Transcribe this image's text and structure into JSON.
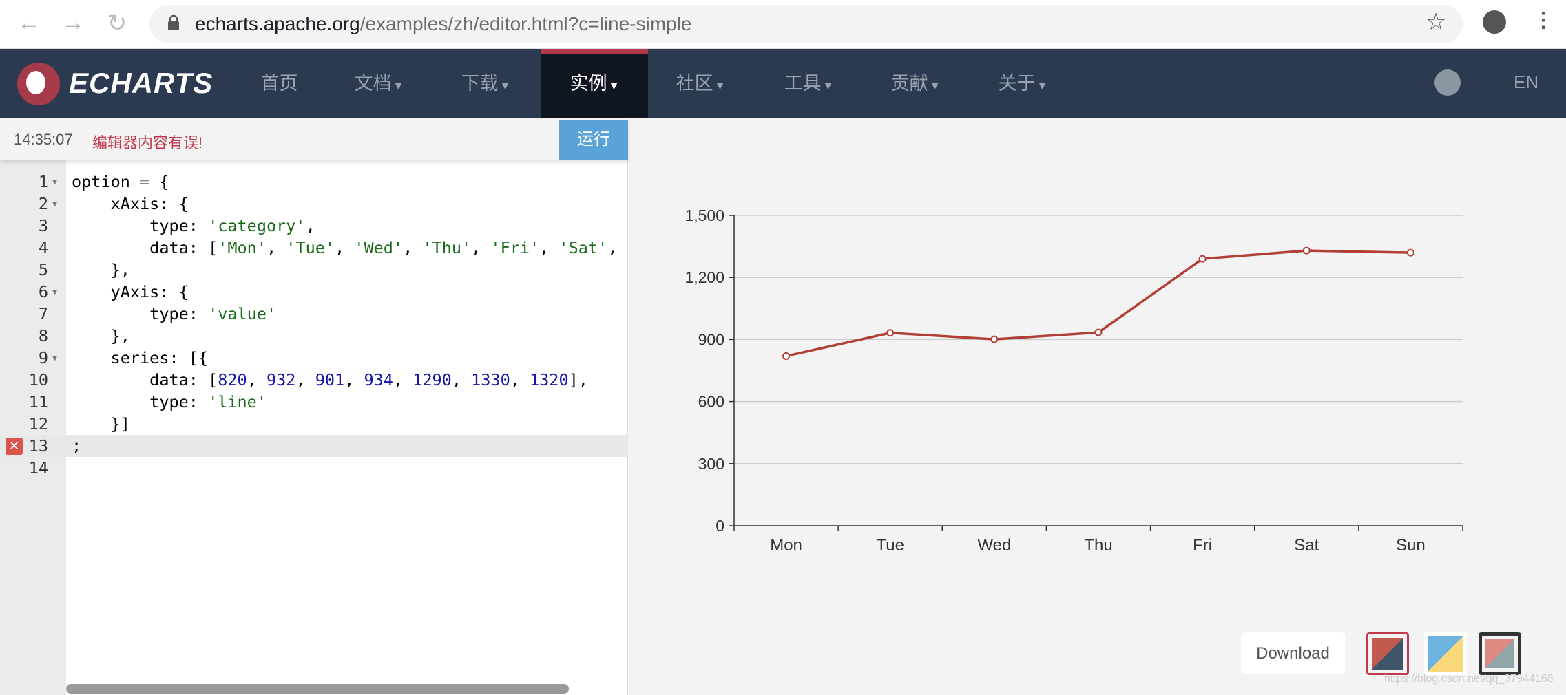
{
  "browser": {
    "url_host": "echarts.apache.org",
    "url_path": "/examples/zh/editor.html?c=line-simple"
  },
  "nav": {
    "logo": "ECHARTS",
    "items": [
      {
        "label": "首页",
        "dropdown": false
      },
      {
        "label": "文档",
        "dropdown": true
      },
      {
        "label": "下载",
        "dropdown": true
      },
      {
        "label": "实例",
        "dropdown": true,
        "active": true
      },
      {
        "label": "社区",
        "dropdown": true
      },
      {
        "label": "工具",
        "dropdown": true
      },
      {
        "label": "贡献",
        "dropdown": true
      },
      {
        "label": "关于",
        "dropdown": true
      }
    ],
    "lang": "EN"
  },
  "editor": {
    "time": "14:35:07",
    "error": "编辑器内容有误!",
    "run_label": "运行",
    "error_line": 13,
    "lines": [
      {
        "n": "1",
        "fold": true,
        "tokens": [
          [
            "option ",
            ""
          ],
          [
            "=",
            "op"
          ],
          [
            " {",
            ""
          ]
        ]
      },
      {
        "n": "2",
        "fold": true,
        "tokens": [
          [
            "    xAxis: {",
            ""
          ]
        ]
      },
      {
        "n": "3",
        "tokens": [
          [
            "        type: ",
            ""
          ],
          [
            "'category'",
            "str"
          ],
          [
            ",",
            ""
          ]
        ]
      },
      {
        "n": "4",
        "tokens": [
          [
            "        data: [",
            ""
          ],
          [
            "'Mon'",
            "str"
          ],
          [
            ", ",
            ""
          ],
          [
            "'Tue'",
            "str"
          ],
          [
            ", ",
            ""
          ],
          [
            "'Wed'",
            "str"
          ],
          [
            ", ",
            ""
          ],
          [
            "'Thu'",
            "str"
          ],
          [
            ", ",
            ""
          ],
          [
            "'Fri'",
            "str"
          ],
          [
            ", ",
            ""
          ],
          [
            "'Sat'",
            "str"
          ],
          [
            ",",
            ""
          ]
        ]
      },
      {
        "n": "5",
        "tokens": [
          [
            "    },",
            ""
          ]
        ]
      },
      {
        "n": "6",
        "fold": true,
        "tokens": [
          [
            "    yAxis: {",
            ""
          ]
        ]
      },
      {
        "n": "7",
        "tokens": [
          [
            "        type: ",
            ""
          ],
          [
            "'value'",
            "str"
          ]
        ]
      },
      {
        "n": "8",
        "tokens": [
          [
            "    },",
            ""
          ]
        ]
      },
      {
        "n": "9",
        "fold": true,
        "tokens": [
          [
            "    series: [{",
            ""
          ]
        ]
      },
      {
        "n": "10",
        "tokens": [
          [
            "        data: [",
            ""
          ],
          [
            "820",
            "num"
          ],
          [
            ", ",
            ""
          ],
          [
            "932",
            "num"
          ],
          [
            ", ",
            ""
          ],
          [
            "901",
            "num"
          ],
          [
            ", ",
            ""
          ],
          [
            "934",
            "num"
          ],
          [
            ", ",
            ""
          ],
          [
            "1290",
            "num"
          ],
          [
            ", ",
            ""
          ],
          [
            "1330",
            "num"
          ],
          [
            ", ",
            ""
          ],
          [
            "1320",
            "num"
          ],
          [
            "],",
            ""
          ]
        ]
      },
      {
        "n": "11",
        "tokens": [
          [
            "        type: ",
            ""
          ],
          [
            "'line'",
            "str"
          ]
        ]
      },
      {
        "n": "12",
        "tokens": [
          [
            "    }]",
            ""
          ]
        ]
      },
      {
        "n": "13",
        "tokens": [
          [
            ";",
            ""
          ]
        ]
      },
      {
        "n": "14",
        "tokens": []
      }
    ]
  },
  "chart_data": {
    "type": "line",
    "categories": [
      "Mon",
      "Tue",
      "Wed",
      "Thu",
      "Fri",
      "Sat",
      "Sun"
    ],
    "series": [
      {
        "values": [
          820,
          932,
          901,
          934,
          1290,
          1330,
          1320
        ],
        "color": "#b13f36"
      }
    ],
    "ylim": [
      0,
      1500
    ],
    "yticks": [
      "0",
      "300",
      "600",
      "900",
      "1,200",
      "1,500"
    ],
    "grid": true
  },
  "download_label": "Download",
  "themes": [
    {
      "id": "default",
      "selected": true
    },
    {
      "id": "light"
    },
    {
      "id": "dark"
    }
  ],
  "watermark": "https://blog.csdn.net/qq_37944168"
}
